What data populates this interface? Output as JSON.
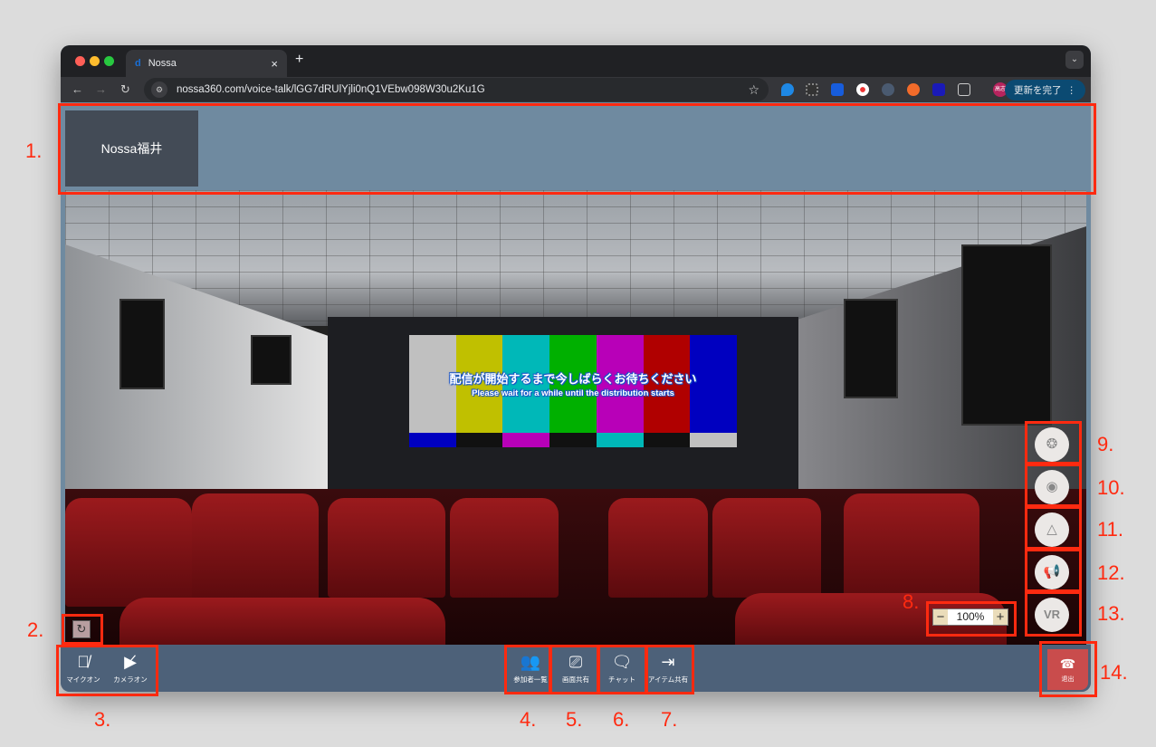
{
  "browser": {
    "tab_title": "Nossa",
    "url": "nossa360.com/voice-talk/lGG7dRUlYjli0nQ1VEbw098W30u2Ku1G",
    "update_label": "更新を完了",
    "avatar_text": "高志"
  },
  "header": {
    "room_name": "Nossa福井"
  },
  "scene": {
    "message_ja": "配信が開始するまで今しばらくお待ちください",
    "message_en": "Please wait for a while until the distribution starts",
    "bar_colors": [
      "#c0c0c0",
      "#c0c000",
      "#00b8b8",
      "#00b000",
      "#b800b8",
      "#b00000",
      "#0000c0"
    ],
    "sub_colors": [
      "#0000c0",
      "#111",
      "#b800b8",
      "#111",
      "#00b8b8",
      "#111",
      "#c0c0c0"
    ]
  },
  "controls": {
    "zoom_level": "100%",
    "zoom_minus": "−",
    "zoom_plus": "+",
    "vr_label": "VR"
  },
  "bottom_bar": {
    "mic": "マイクオン",
    "camera": "カメラオン",
    "participants": "参加者一覧",
    "screen_share": "画面共有",
    "chat": "チャット",
    "item_share": "アイテム共有",
    "exit": "退出"
  },
  "annotations": [
    "1.",
    "2.",
    "3.",
    "4.",
    "5.",
    "6.",
    "7.",
    "8.",
    "9.",
    "10.",
    "11.",
    "12.",
    "13.",
    "14."
  ]
}
